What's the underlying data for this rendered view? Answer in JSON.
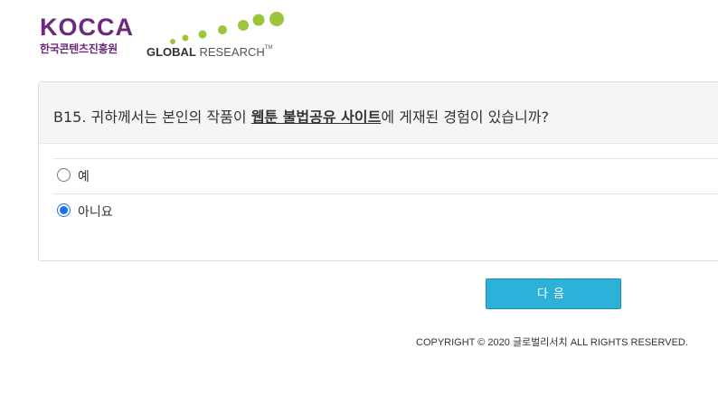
{
  "brand": {
    "kocca_name": "KOCCA",
    "kocca_korean": "한국콘텐츠진흥원",
    "gr_bold": "GLOBAL",
    "gr_light": " RESEARCH",
    "gr_tm": "TM",
    "kocca_color": "#6b2a7e",
    "gr_dot_color": "#9bc53d"
  },
  "question": {
    "prefix": "B15. 귀하께서는 본인의 작품이 ",
    "emphasis": "웹툰 불법공유 사이트",
    "suffix": "에 게재된 경험이 있습니까?"
  },
  "options": [
    {
      "label": "예",
      "selected": false
    },
    {
      "label": "아니요",
      "selected": true
    }
  ],
  "next_button": {
    "label": "다음",
    "color": "#2eb1d9"
  },
  "footer": {
    "copyright": "COPYRIGHT © 2020 글로벌리서치 ALL RIGHTS RESERVED."
  }
}
